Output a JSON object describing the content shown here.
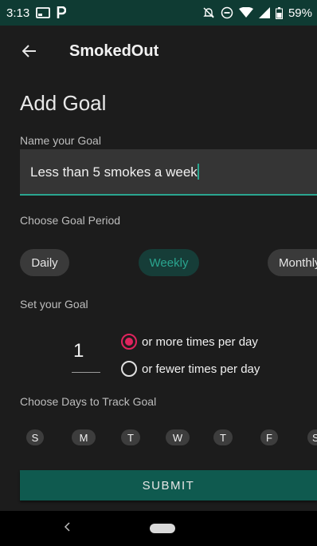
{
  "status_bar": {
    "time": "3:13",
    "battery": "59%",
    "icons": [
      "cast-icon",
      "parking-icon",
      "no-alarm-icon",
      "do-not-disturb-icon",
      "wifi-icon",
      "signal-icon",
      "battery-icon"
    ]
  },
  "app_bar": {
    "title": "SmokedOut",
    "back_icon": "arrow-left-icon"
  },
  "page": {
    "title": "Add Goal"
  },
  "goal_name": {
    "label": "Name your Goal",
    "value": "Less than 5 smokes a week"
  },
  "goal_period": {
    "label": "Choose Goal Period",
    "options": [
      "Daily",
      "Weekly",
      "Monthly"
    ],
    "selected": "Weekly"
  },
  "set_goal": {
    "label": "Set your Goal",
    "count": "1",
    "options": [
      "or more times per day",
      "or fewer times per day"
    ],
    "selected": "or more times per day"
  },
  "track_days": {
    "label": "Choose Days to Track Goal",
    "days": [
      "S",
      "M",
      "T",
      "W",
      "T",
      "F",
      "S"
    ]
  },
  "submit": {
    "label": "SUBMIT"
  },
  "colors": {
    "status_bar": "#0f3b33",
    "accent": "#2aa58f",
    "radio_selected": "#e0245e",
    "submit_bg": "#0f5a4f",
    "background": "#1c1c1c"
  }
}
